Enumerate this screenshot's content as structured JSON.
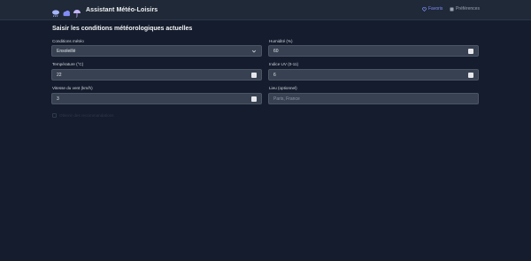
{
  "app": {
    "title": "Assistant Météo-Loisirs",
    "brand_icons": [
      "rain-cloud-icon",
      "cloud-icon",
      "umbrella-icon"
    ]
  },
  "nav": {
    "favorites_label": "Favoris",
    "preferences_label": "Préférences"
  },
  "form": {
    "title": "Saisir les conditions météorologiques actuelles",
    "conditions": {
      "label": "Conditions météo",
      "value": "Ensoleillé"
    },
    "humidity": {
      "label": "Humidité (%)",
      "value": "60"
    },
    "temperature": {
      "label": "Température (°C)",
      "value": "22"
    },
    "uv": {
      "label": "Indice UV (0-11)",
      "value": "6"
    },
    "wind": {
      "label": "Vitesse du vent (km/h)",
      "value": "3"
    },
    "location": {
      "label": "Lieu (optionnel)",
      "placeholder": "Paris, France"
    },
    "option_label": "Obtenir des recommandations"
  },
  "colors": {
    "background": "#141c2d",
    "topbar": "#1f2937",
    "field": "#374151",
    "accent": "#818cf8"
  }
}
